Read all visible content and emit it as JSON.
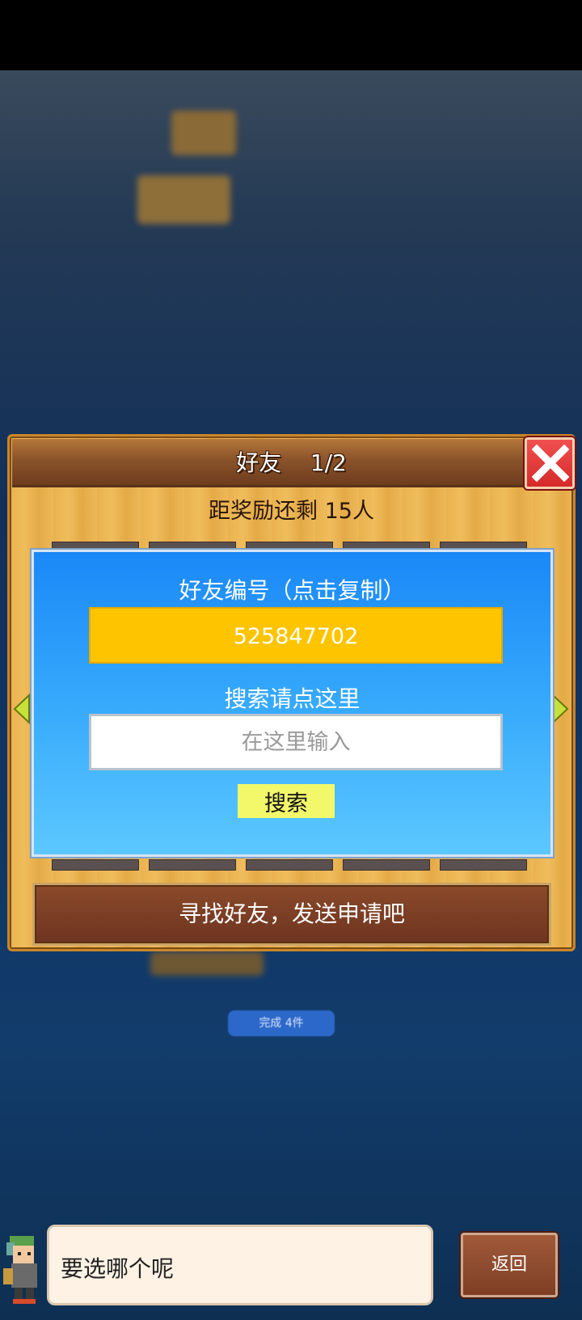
{
  "dialog": {
    "title": "好友    1/2",
    "reward_text": "距奖励还剩 15人",
    "friend_code_label": "好友编号（点击复制）",
    "friend_code": "525847702",
    "search_label": "搜索请点这里",
    "search_placeholder": "在这里输入",
    "search_button": "搜索",
    "find_friends": "寻找好友，发送申请吧"
  },
  "background": {
    "done_pill": "完成 4件"
  },
  "bottom": {
    "speech": "要选哪个呢",
    "back_button": "返回"
  },
  "colors": {
    "friend_code_bg": "#ffc400",
    "search_button_bg": "#f2f86a",
    "close_button": "#d62a2a"
  }
}
